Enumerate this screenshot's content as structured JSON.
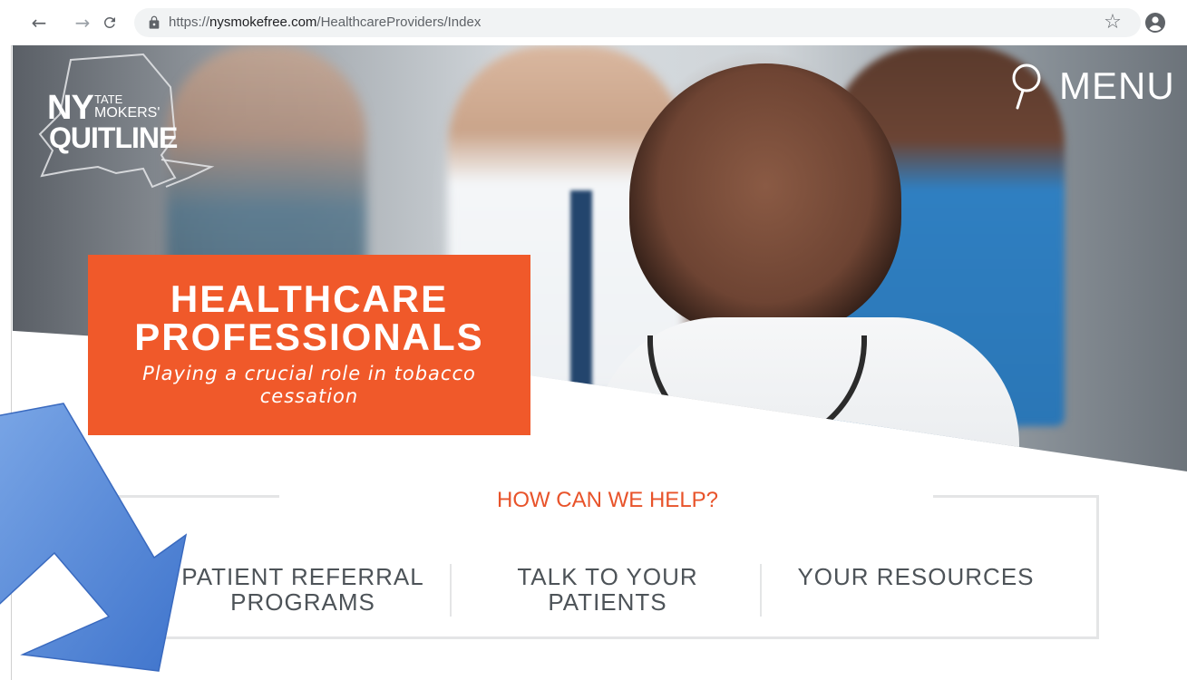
{
  "browser": {
    "url_protocol": "https://",
    "url_host": "nysmokefree.com",
    "url_path": "/HealthcareProviders/Index",
    "back_icon": "arrow-left-icon",
    "forward_icon": "arrow-right-icon",
    "reload_icon": "reload-icon",
    "lock_icon": "lock-icon",
    "bookmark_icon": "star-icon",
    "profile_icon": "account-circle-icon"
  },
  "header": {
    "logo": {
      "line1_big": "NY",
      "line1_small_top": "TATE",
      "line1_small_bottom": "MOKERS'",
      "line2": "QUITLINE"
    },
    "menu_label": "MENU",
    "search_icon": "search-icon"
  },
  "banner": {
    "title_line1": "HEALTHCARE",
    "title_line2": "PROFESSIONALS",
    "subtitle": "Playing a crucial role in tobacco cessation",
    "background_color": "#f0592a"
  },
  "help": {
    "title": "HOW CAN WE HELP?",
    "items": [
      {
        "line1": "PATIENT REFERRAL",
        "line2": "PROGRAMS"
      },
      {
        "line1": "TALK TO YOUR",
        "line2": "PATIENTS"
      },
      {
        "line1": "YOUR RESOURCES",
        "line2": ""
      }
    ],
    "accent_color": "#e8532a"
  },
  "overlay": {
    "arrow_color": "#4a7fd2"
  }
}
